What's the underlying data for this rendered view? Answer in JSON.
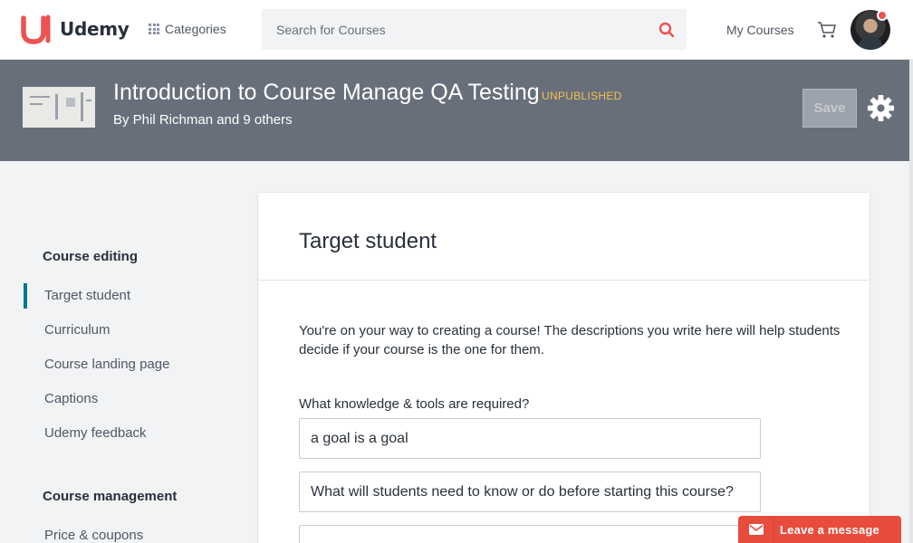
{
  "header": {
    "brand": "Udemy",
    "categories_label": "Categories",
    "search_placeholder": "Search for Courses",
    "my_courses_label": "My Courses",
    "brand_color": "#ec5252",
    "icons": [
      "udemy-logo",
      "grid-icon",
      "search-icon",
      "cart-icon",
      "avatar",
      "notification-dot"
    ]
  },
  "course": {
    "title": "Introduction to Course Manage QA Testing",
    "status": "UNPUBLISHED",
    "byline": "By Phil Richman and 9 others",
    "save_label": "Save",
    "icons": [
      "course-thumbnail",
      "gear-icon"
    ]
  },
  "sidebar": {
    "editing_heading": "Course editing",
    "editing_items": [
      {
        "label": "Target student",
        "active": true
      },
      {
        "label": "Curriculum",
        "active": false
      },
      {
        "label": "Course landing page",
        "active": false
      },
      {
        "label": "Captions",
        "active": false
      },
      {
        "label": "Udemy feedback",
        "active": false
      }
    ],
    "management_heading": "Course management",
    "management_items": [
      {
        "label": "Price & coupons",
        "active": false
      }
    ],
    "accent_color": "#007791"
  },
  "main": {
    "title": "Target student",
    "intro": "You're on your way to creating a course! The descriptions you write here will help students decide if your course is the one for them.",
    "requirements_label": "What knowledge & tools are required?",
    "fields": [
      {
        "value": "a goal is a goal",
        "placeholder": ""
      },
      {
        "value": "",
        "placeholder": "What will students need to know or do before starting this course?"
      },
      {
        "value": "",
        "placeholder": ""
      }
    ]
  },
  "chat": {
    "label": "Leave a message",
    "color": "#e84c3d",
    "icon": "mail-icon"
  }
}
